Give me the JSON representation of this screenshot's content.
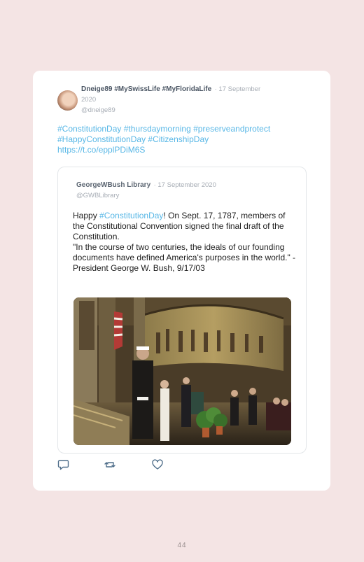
{
  "tweet": {
    "user_display": "Dneige89 #MySwissLife #MyFloridaLife",
    "date_sep": "· 17 September",
    "date_year": "2020",
    "handle": "@dneige89",
    "text_lines": [
      "#ConstitutionDay #thursdaymorning #preserveandprotect",
      "#HappyConstitutionDay #CitizenshipDay",
      "https://t.co/epplPDiM6S"
    ]
  },
  "quoted": {
    "user_display": "GeorgeWBush Library",
    "date": "· 17 September 2020",
    "handle": "@GWBLibrary",
    "body_prefix": "Happy ",
    "body_hashtag": "#ConstitutionDay",
    "body_suffix": "! On Sept. 17, 1787, members of the Constitutional Convention signed the final draft of the Constitution.",
    "body_quote": "\"In the course of two centuries, the ideals of our founding documents have defined America's purposes in the world.\" -President George W. Bush, 9/17/03",
    "image_icon": "rotunda-photo"
  },
  "actions": {
    "reply": "reply-icon",
    "retweet": "retweet-icon",
    "like": "heart-icon"
  },
  "page_number": "44",
  "colors": {
    "background": "#f4e4e4",
    "card": "#ffffff",
    "link": "#58b7e6"
  }
}
